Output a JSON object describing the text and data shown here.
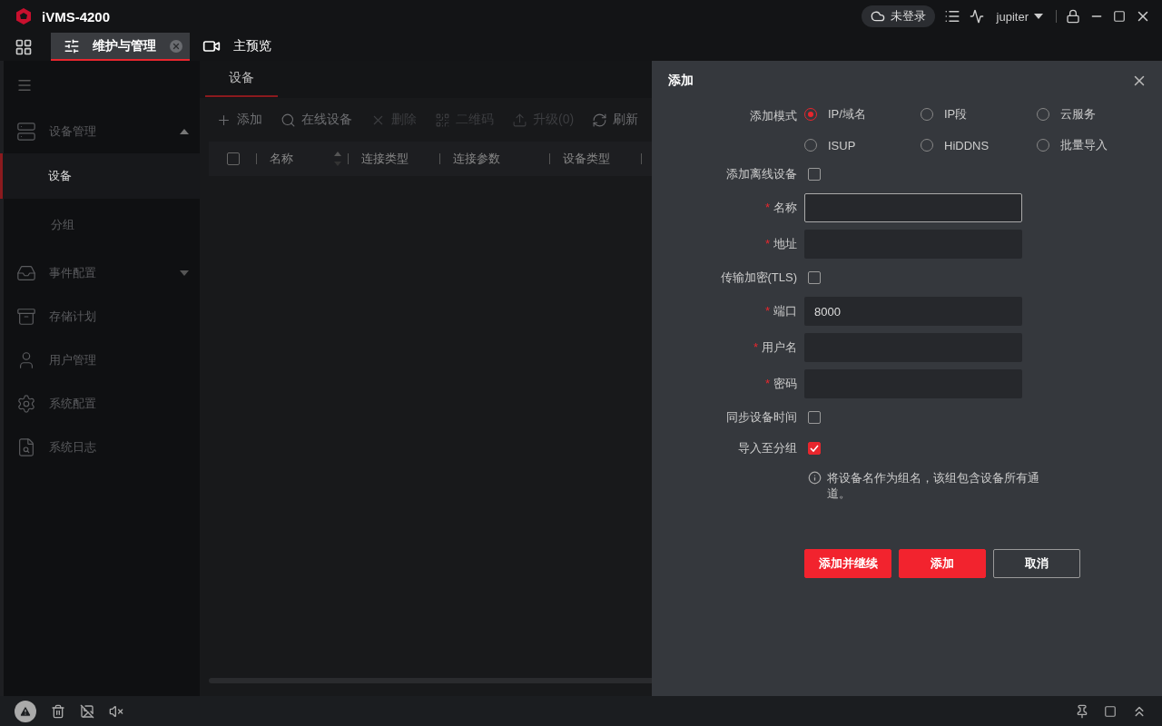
{
  "title_bar": {
    "app_name": "iVMS-4200",
    "login_status": "未登录",
    "user": "jupiter"
  },
  "tabs": [
    {
      "label": "维护与管理",
      "selected": true,
      "closable": true
    },
    {
      "label": "主预览",
      "selected": false,
      "closable": false
    }
  ],
  "sidebar": {
    "items": [
      {
        "label": "设备管理",
        "expanded": true,
        "children": [
          {
            "label": "设备",
            "selected": true
          },
          {
            "label": "分组",
            "selected": false
          }
        ]
      },
      {
        "label": "事件配置",
        "expanded": false
      },
      {
        "label": "存储计划"
      },
      {
        "label": "用户管理"
      },
      {
        "label": "系统配置"
      },
      {
        "label": "系统日志"
      }
    ]
  },
  "main": {
    "tabs": [
      {
        "label": "设备",
        "selected": true
      }
    ],
    "toolbar": [
      {
        "label": "添加",
        "disabled": false
      },
      {
        "label": "在线设备",
        "disabled": false
      },
      {
        "label": "删除",
        "disabled": true
      },
      {
        "label": "二维码",
        "disabled": true
      },
      {
        "label": "升级(0)",
        "disabled": true
      },
      {
        "label": "刷新",
        "disabled": false
      }
    ],
    "table": {
      "select_all": {
        "checked": false
      },
      "columns": [
        {
          "label": "名称",
          "sortable": true
        },
        {
          "label": "连接类型",
          "sortable": false
        },
        {
          "label": "连接参数",
          "sortable": false
        },
        {
          "label": "设备类型",
          "sortable": false
        }
      ]
    }
  },
  "dialog": {
    "title": "添加",
    "mode": {
      "label": "添加模式",
      "options": [
        {
          "label": "IP/域名",
          "selected": true
        },
        {
          "label": "IP段",
          "selected": false
        },
        {
          "label": "云服务",
          "selected": false
        },
        {
          "label": "ISUP",
          "selected": false
        },
        {
          "label": "HiDDNS",
          "selected": false
        },
        {
          "label": "批量导入",
          "selected": false
        }
      ]
    },
    "fields": [
      {
        "kind": "checkbox",
        "label": "添加离线设备",
        "checked": false
      },
      {
        "kind": "input",
        "label": "名称",
        "required_mark": "*",
        "focused": true
      },
      {
        "kind": "input",
        "label": "地址",
        "required_mark": "*",
        "focused": false
      },
      {
        "kind": "checkbox",
        "label": "传输加密(TLS)",
        "checked": false
      },
      {
        "kind": "input",
        "label": "端口",
        "required_mark": "*",
        "focused": false,
        "value": "8000"
      },
      {
        "kind": "input",
        "label": "用户名",
        "required_mark": "*",
        "focused": false
      },
      {
        "kind": "input",
        "label": "密码",
        "required_mark": "*",
        "focused": false
      },
      {
        "kind": "checkbox",
        "label": "同步设备时间",
        "checked": false
      },
      {
        "kind": "checkbox",
        "label": "导入至分组",
        "checked": true
      }
    ],
    "hint": "将设备名作为组名，该组包含设备所有通道。",
    "buttons": [
      {
        "label": "添加并继续",
        "kind": "primary"
      },
      {
        "label": "添加",
        "kind": "primary"
      },
      {
        "label": "取消",
        "kind": "secondary"
      }
    ]
  }
}
